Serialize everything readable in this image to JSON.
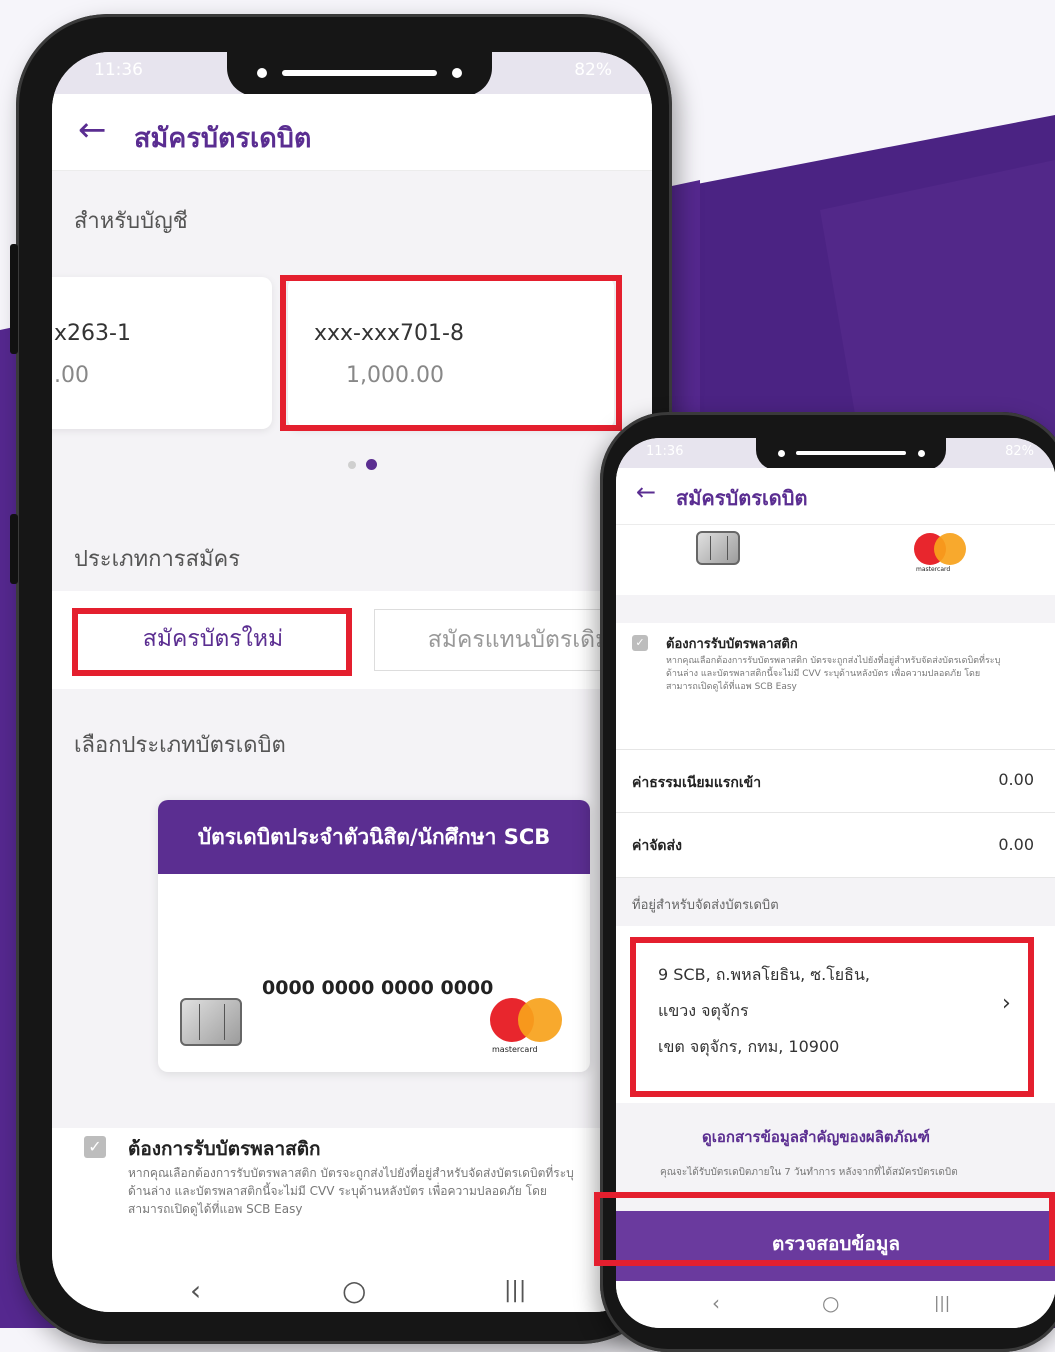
{
  "phone1": {
    "status": {
      "time": "11:36",
      "right": "82%"
    },
    "header": {
      "title": "สมัครบัตรเดบิต"
    },
    "account_section_label": "สำหรับบัญชี",
    "accounts": [
      {
        "number": "x263-1",
        "balance": ".00"
      },
      {
        "number": "xxx-xxx701-8",
        "balance": "1,000.00"
      }
    ],
    "apply_type_label": "ประเภทการสมัคร",
    "apply_new": "สมัครบัตรใหม่",
    "apply_replace": "สมัครแทนบัตรเดิม",
    "card_type_label": "เลือกประเภทบัตรเดบิต",
    "card": {
      "name": "บัตรเดบิตประจำตัวนิสิต/นักศึกษา SCB",
      "number": "0000 0000 0000 0000",
      "brand": "mastercard"
    },
    "plastic": {
      "title": "ต้องการรับบัตรพลาสติก",
      "desc": "หากคุณเลือกต้องการรับบัตรพลาสติก บัตรจะถูกส่งไปยังที่อยู่สำหรับจัดส่งบัตรเดบิตที่ระบุด้านล่าง และบัตรพลาสติกนี้จะไม่มี CVV ระบุด้านหลังบัตร เพื่อความปลอดภัย โดยสามารถเปิดดูได้ที่แอพ SCB Easy"
    },
    "nav": {
      "back": "‹",
      "home": "○",
      "recent": "|||"
    }
  },
  "phone2": {
    "status": {
      "time": "11:36",
      "right": "82%"
    },
    "header": {
      "title": "สมัครบัตรเดบิต"
    },
    "card_brand": "mastercard",
    "plastic": {
      "title": "ต้องการรับบัตรพลาสติก",
      "desc": "หากคุณเลือกต้องการรับบัตรพลาสติก บัตรจะถูกส่งไปยังที่อยู่สำหรับจัดส่งบัตรเดบิตที่ระบุด้านล่าง และบัตรพลาสติกนี้จะไม่มี CVV ระบุด้านหลังบัตร เพื่อความปลอดภัย โดยสามารถเปิดดูได้ที่แอพ SCB Easy"
    },
    "fee_label": "ค่าธรรมเนียมแรกเข้า",
    "fee_value": "0.00",
    "shipping_label": "ค่าจัดส่ง",
    "shipping_value": "0.00",
    "address_label": "ที่อยู่สำหรับจัดส่งบัตรเดบิต",
    "address": [
      "9 SCB, ถ.พหลโยธิน, ซ.โยธิน,",
      "แขวง จตุจักร",
      "เขต จตุจักร, กทม, 10900"
    ],
    "doc_link": "ดูเอกสารข้อมูลสำคัญของผลิตภัณฑ์",
    "note": "คุณจะได้รับบัตรเดบิตภายใน 7 วันทำการ หลังจากที่ได้สมัครบัตรเดบิต",
    "verify_button": "ตรวจสอบข้อมูล",
    "nav": {
      "back": "‹",
      "home": "○",
      "recent": "|||"
    }
  },
  "colors": {
    "brand_purple": "#5b2e91",
    "highlight_red": "#e41f2e"
  }
}
